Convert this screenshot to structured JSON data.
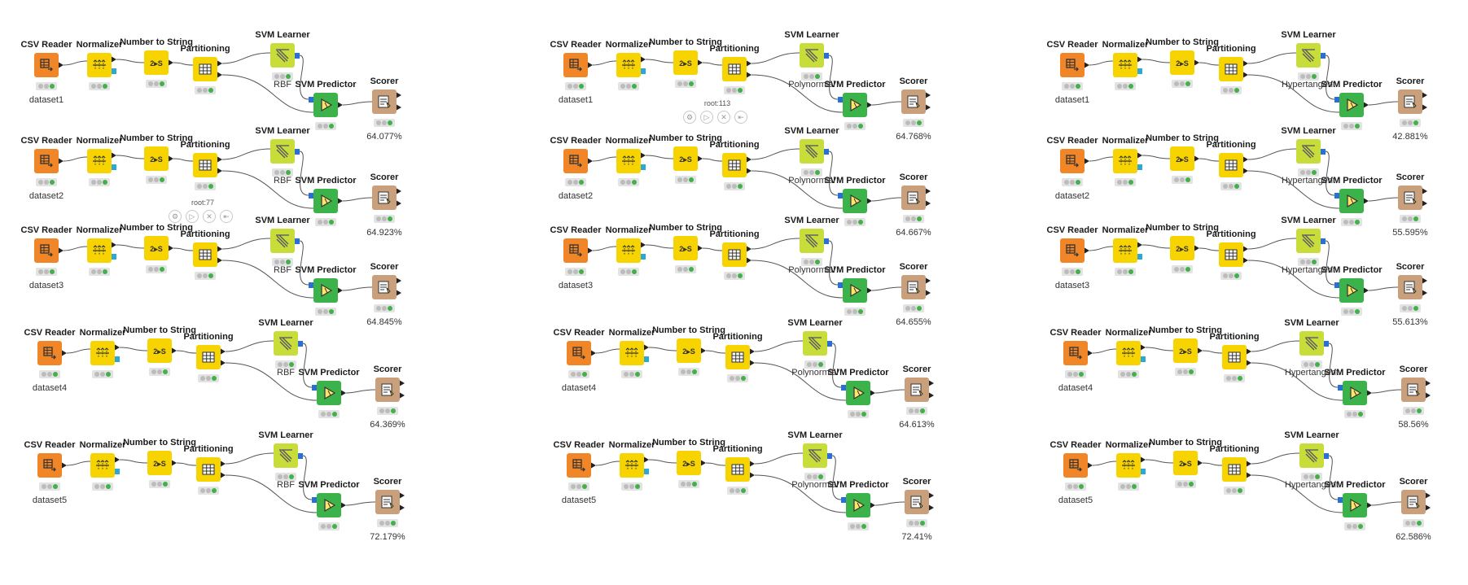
{
  "node_titles": {
    "csv_reader": "CSV Reader",
    "normalizer": "Normalizer",
    "number_to_string": "Number to String",
    "partitioning": "Partitioning",
    "svm_learner": "SVM Learner",
    "svm_predictor": "SVM Predictor",
    "scorer": "Scorer"
  },
  "icons": {
    "csv_reader": "table-arrow-icon",
    "normalizer": "normalize-icon",
    "number_to_string": "number-to-string-icon",
    "partitioning": "grid-icon",
    "svm_learner": "svm-learner-icon",
    "svm_predictor": "play-triangle-icon",
    "scorer": "scorer-icon"
  },
  "colors": {
    "reader": "#f08628",
    "manipulator": "#f7d300",
    "learner": "#c8dd3a",
    "predictor": "#3bb34a",
    "scorer": "#c9a07b",
    "model_port": "#2a6fd6",
    "ok_status": "#43b049"
  },
  "hover_toolbars": [
    {
      "tag": "root:77"
    },
    {
      "tag": "root:113"
    }
  ],
  "columns": [
    {
      "kernel": "RBF",
      "workflows": [
        {
          "dataset": "dataset1",
          "accuracy": "64.077%"
        },
        {
          "dataset": "dataset2",
          "accuracy": "64.923%"
        },
        {
          "dataset": "dataset3",
          "accuracy": "64.845%"
        },
        {
          "dataset": "dataset4",
          "accuracy": "64.369%"
        },
        {
          "dataset": "dataset5",
          "accuracy": "72.179%"
        }
      ]
    },
    {
      "kernel": "Polynormial",
      "workflows": [
        {
          "dataset": "dataset1",
          "accuracy": "64.768%"
        },
        {
          "dataset": "dataset2",
          "accuracy": "64.667%"
        },
        {
          "dataset": "dataset3",
          "accuracy": "64.655%"
        },
        {
          "dataset": "dataset4",
          "accuracy": "64.613%"
        },
        {
          "dataset": "dataset5",
          "accuracy": "72.41%"
        }
      ]
    },
    {
      "kernel": "Hypertangent",
      "workflows": [
        {
          "dataset": "dataset1",
          "accuracy": "42.881%"
        },
        {
          "dataset": "dataset2",
          "accuracy": "55.595%"
        },
        {
          "dataset": "dataset3",
          "accuracy": "55.613%"
        },
        {
          "dataset": "dataset4",
          "accuracy": "58.56%"
        },
        {
          "dataset": "dataset5",
          "accuracy": "62.586%"
        }
      ]
    }
  ]
}
